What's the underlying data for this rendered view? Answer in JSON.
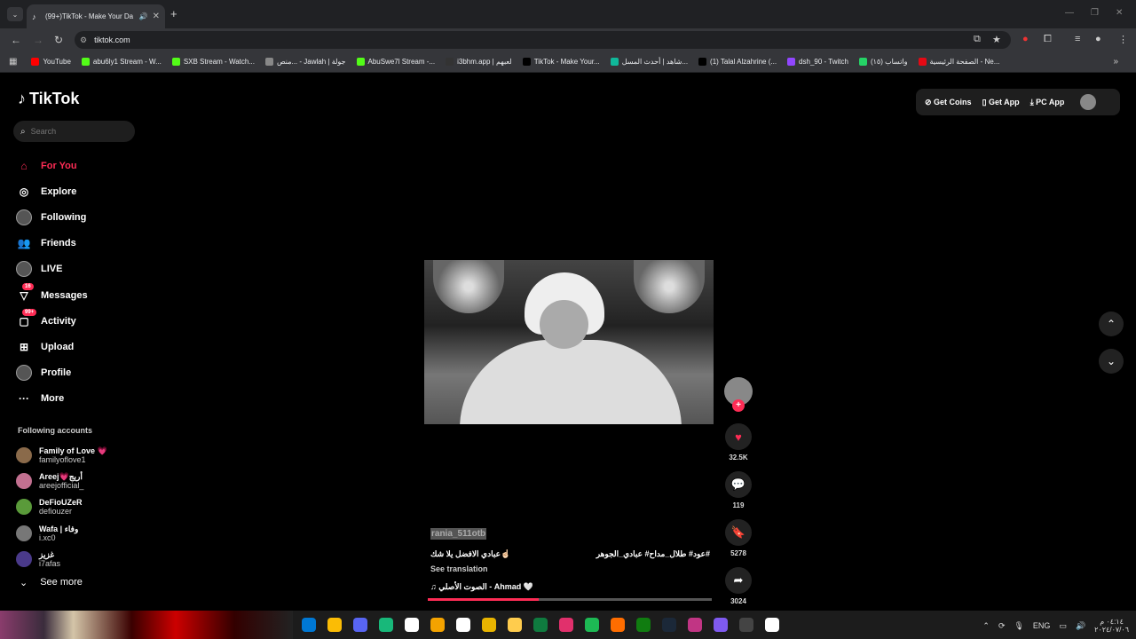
{
  "browser": {
    "tab_title": "(99+)TikTok - Make Your Da",
    "url": "tiktok.com",
    "bookmarks": [
      {
        "label": "YouTube",
        "color": "#ff0000"
      },
      {
        "label": "abu6ly1 Stream - W...",
        "color": "#53fc18"
      },
      {
        "label": "SXB Stream - Watch...",
        "color": "#53fc18"
      },
      {
        "label": "منص... - Jawlah | جولة",
        "color": "#888888"
      },
      {
        "label": "AbuSwe7l Stream -...",
        "color": "#53fc18"
      },
      {
        "label": "i3bhm.app | لعبهم",
        "color": "#333333"
      },
      {
        "label": "TikTok - Make Your...",
        "color": "#000000"
      },
      {
        "label": "شاهد | أحدث المسل...",
        "color": "#10b89a"
      },
      {
        "label": "(1) Talal Alzahrine (...",
        "color": "#000000"
      },
      {
        "label": "dsh_90 - Twitch",
        "color": "#9146ff"
      },
      {
        "label": "واتساب (١٥)",
        "color": "#25d366"
      },
      {
        "label": "الصفحة الرئيسية - Ne...",
        "color": "#e50914"
      }
    ]
  },
  "tiktok": {
    "logo": "TikTok",
    "search_placeholder": "Search",
    "nav": [
      {
        "label": "For You",
        "icon": "home-icon",
        "active": true
      },
      {
        "label": "Explore",
        "icon": "compass-icon"
      },
      {
        "label": "Following",
        "icon": "following-avatar-icon"
      },
      {
        "label": "Friends",
        "icon": "friends-icon"
      },
      {
        "label": "LIVE",
        "icon": "live-icon"
      },
      {
        "label": "Messages",
        "icon": "messages-icon",
        "badge": "16"
      },
      {
        "label": "Activity",
        "icon": "activity-icon",
        "badge": "99+"
      },
      {
        "label": "Upload",
        "icon": "upload-icon"
      },
      {
        "label": "Profile",
        "icon": "profile-icon"
      },
      {
        "label": "More",
        "icon": "more-icon"
      }
    ],
    "following_title": "Following accounts",
    "following": [
      {
        "name": "Family of Love 💗",
        "user": "familyoflove1",
        "color": "#8a6a4a"
      },
      {
        "name": "Areej💗أريج",
        "user": "areejofficial_",
        "color": "#c27090"
      },
      {
        "name": "DeFioUZeR",
        "user": "defiouzer",
        "color": "#5a9a3a"
      },
      {
        "name": "Wafa | وفاء",
        "user": "i.xc0",
        "color": "#777777"
      },
      {
        "name": "غزيز",
        "user": "i7afas",
        "color": "#4a3a8a"
      }
    ],
    "see_more": "See more",
    "top_actions": {
      "coins": "Get Coins",
      "app": "Get App",
      "pc": "PC App"
    },
    "video": {
      "counts": {
        "likes": "32.5K",
        "comments": "119",
        "saves": "5278",
        "shares": "3024"
      },
      "author": "rania_511otb",
      "caption_left": "عبادي الافضل يلا شك☝🏻",
      "caption_right": "عود# طلال_مداح# عبادي_الجوهر#",
      "see_translation": "See translation",
      "music": "الصوت الأصلي - Ahmad 🤍",
      "progress": 0.39
    }
  },
  "taskbar": {
    "lang": "ENG",
    "time": "٠٤:١٤ م",
    "date": "٢٠٢٤/٠٧/٠٦",
    "apps": [
      "#0078d4",
      "#fbbc05",
      "#5865f2",
      "#18b87a",
      "#ffffff",
      "#f4a300",
      "#ffffff",
      "#e8b400",
      "#ffcc4d",
      "#0f7b3f",
      "#e1306c",
      "#1db954",
      "#ff6d00",
      "#107c10",
      "#1b2838",
      "#c13584",
      "#7f5af0",
      "#444444",
      "#ffffff"
    ]
  }
}
